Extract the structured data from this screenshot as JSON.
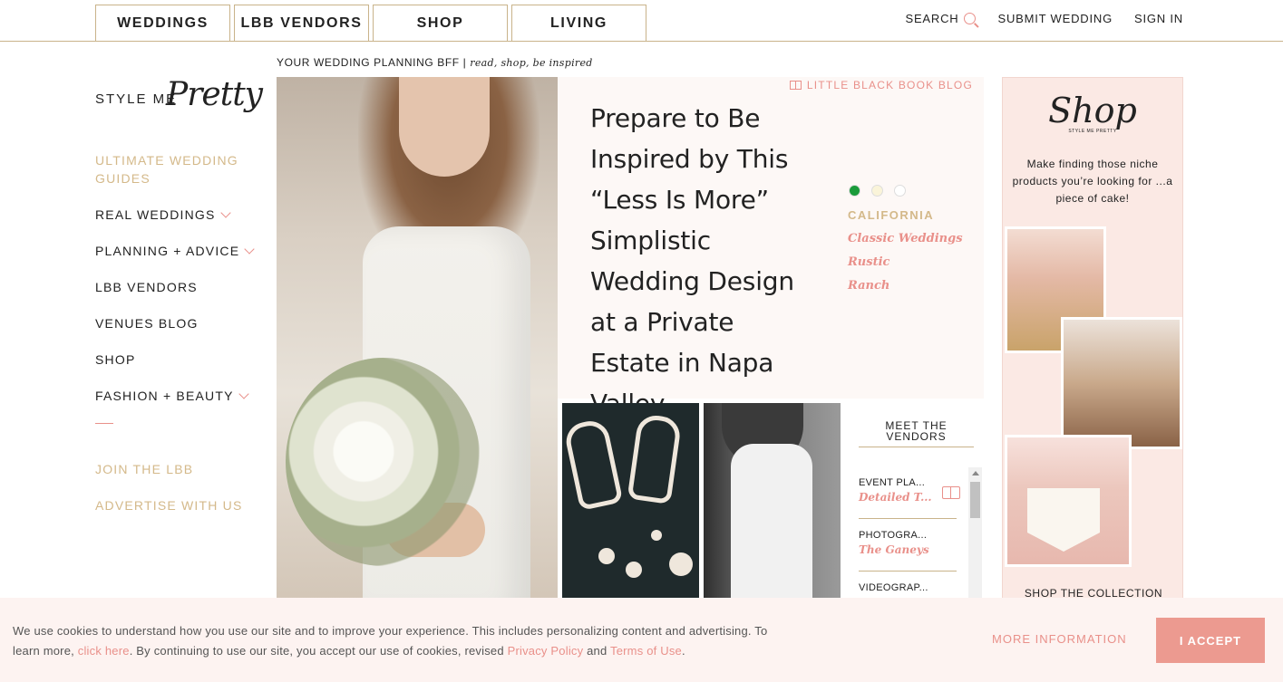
{
  "topnav": {
    "tabs": [
      "WEDDINGS",
      "LBB VENDORS",
      "SHOP",
      "LIVING"
    ],
    "search_label": "SEARCH",
    "submit_label": "SUBMIT WEDDING",
    "signin_label": "SIGN IN"
  },
  "tagline": {
    "main": "YOUR WEDDING PLANNING BFF",
    "separator": "|",
    "italic": "read, shop, be inspired"
  },
  "logo": {
    "style_me": "STYLE ME",
    "pretty": "Pretty"
  },
  "sidebar": {
    "items": [
      {
        "label": "ULTIMATE WEDDING GUIDES"
      },
      {
        "label": "REAL WEDDINGS"
      },
      {
        "label": "PLANNING + ADVICE"
      },
      {
        "label": "LBB VENDORS"
      },
      {
        "label": "VENUES BLOG"
      },
      {
        "label": "SHOP"
      },
      {
        "label": "FASHION + BEAUTY"
      }
    ],
    "footer_links": [
      {
        "label": "JOIN THE LBB"
      },
      {
        "label": "ADVERTISE WITH US"
      }
    ]
  },
  "feature": {
    "blog_tag": "LITTLE BLACK BOOK BLOG",
    "headline": "Prepare to Be Inspired by This “Less Is More” Simplistic Wedding Design at a Private Estate in Napa Valley",
    "colors": [
      "#1a9b3a",
      "#faf4d9",
      "#ffffff"
    ],
    "region": "CALIFORNIA",
    "categories": [
      "Classic Weddings",
      "Rustic",
      "Ranch"
    ]
  },
  "vendors": {
    "title_line1": "MEET THE",
    "title_line2": "VENDORS",
    "items": [
      {
        "role": "EVENT PLA...",
        "name": "Detailed T..."
      },
      {
        "role": "PHOTOGRA...",
        "name": "The Ganeys"
      },
      {
        "role": "VIDEOGRAP...",
        "name": ""
      }
    ]
  },
  "shop_ad": {
    "logo": "Shop",
    "sub": "STYLE ME PRETTY",
    "copy": "Make finding those niche products you’re looking for ...a piece of cake!",
    "cta": "SHOP THE COLLECTION"
  },
  "cookie": {
    "text_1": "We use cookies to understand how you use our site and to improve your experience. This includes personalizing content and advertising. To learn more, ",
    "link_click": "click here",
    "text_2": ". By continuing to use our site, you accept our use of cookies, revised ",
    "link_privacy": "Privacy Policy",
    "text_3": " and ",
    "link_terms": "Terms of Use",
    "text_4": ".",
    "more_info": "MORE INFORMATION",
    "accept": "I ACCEPT"
  }
}
